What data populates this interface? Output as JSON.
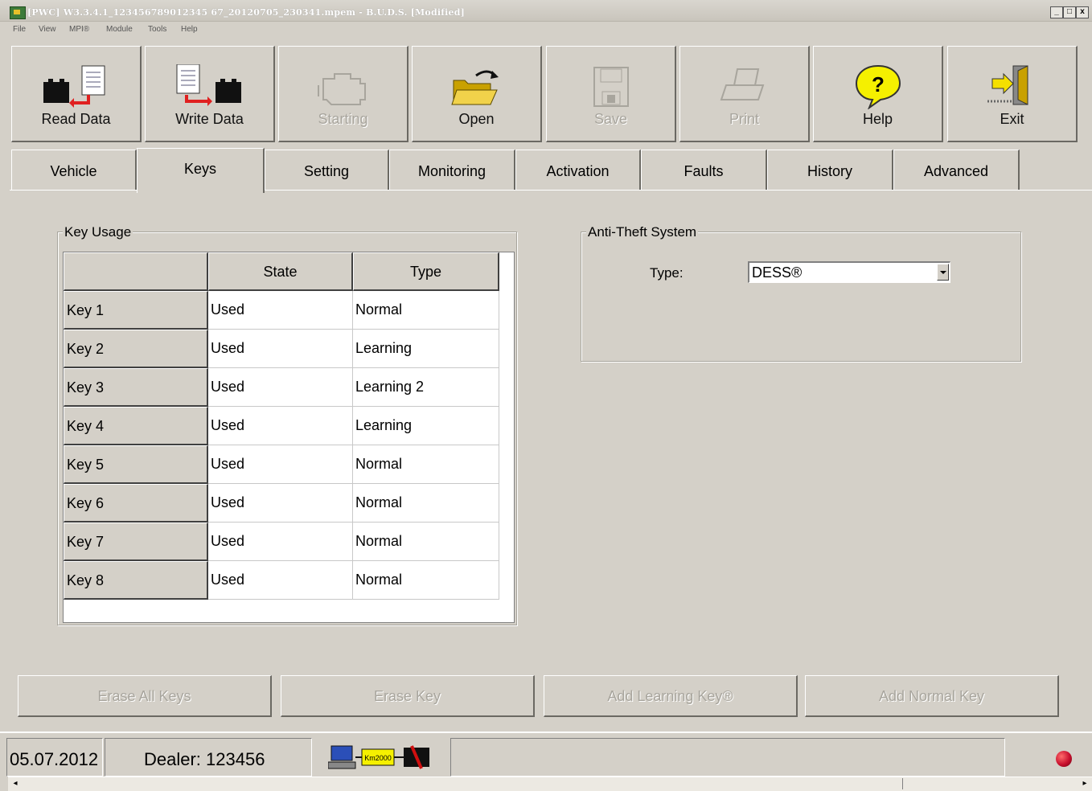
{
  "window": {
    "title": "[PWC] W3.3.4.1_123456789012345 67_20120705_230341.mpem - B.U.D.S. [Modified]",
    "controls": [
      "_",
      "□",
      "x"
    ]
  },
  "menu": [
    "File",
    "View",
    "MPI®",
    "Module",
    "Tools",
    "Help"
  ],
  "toolbar": [
    {
      "label": "Read Data",
      "icon": "read-data-icon",
      "enabled": true
    },
    {
      "label": "Write Data",
      "icon": "write-data-icon",
      "enabled": true
    },
    {
      "label": "Starting",
      "icon": "engine-icon",
      "enabled": false
    },
    {
      "label": "Open",
      "icon": "folder-open-icon",
      "enabled": true
    },
    {
      "label": "Save",
      "icon": "floppy-disk-icon",
      "enabled": false
    },
    {
      "label": "Print",
      "icon": "printer-icon",
      "enabled": false
    },
    {
      "label": "Help",
      "icon": "help-question-icon",
      "enabled": true
    },
    {
      "label": "Exit",
      "icon": "exit-door-icon",
      "enabled": true
    }
  ],
  "tabs": [
    "Vehicle",
    "Keys",
    "Setting",
    "Monitoring",
    "Activation",
    "Faults",
    "History",
    "Advanced"
  ],
  "active_tab": "Keys",
  "key_usage": {
    "legend": "Key Usage",
    "columns": [
      "State",
      "Type"
    ],
    "rows": [
      {
        "key": "Key 1",
        "state": "Used",
        "type": "Normal"
      },
      {
        "key": "Key 2",
        "state": "Used",
        "type": "Learning"
      },
      {
        "key": "Key 3",
        "state": "Used",
        "type": "Learning 2"
      },
      {
        "key": "Key 4",
        "state": "Used",
        "type": "Learning"
      },
      {
        "key": "Key 5",
        "state": "Used",
        "type": "Normal"
      },
      {
        "key": "Key 6",
        "state": "Used",
        "type": "Normal"
      },
      {
        "key": "Key 7",
        "state": "Used",
        "type": "Normal"
      },
      {
        "key": "Key 8",
        "state": "Used",
        "type": "Normal"
      }
    ]
  },
  "anti_theft": {
    "legend": "Anti-Theft System",
    "type_label": "Type:",
    "type_value": "DESS®"
  },
  "actions": [
    {
      "label": "Erase All Keys",
      "enabled": false
    },
    {
      "label": "Erase Key",
      "enabled": false
    },
    {
      "label": "Add Learning Key®",
      "enabled": false
    },
    {
      "label": "Add Normal Key",
      "enabled": false
    }
  ],
  "status": {
    "date": "05.07.2012",
    "dealer": "Dealer: 123456",
    "interface_label": "Km2000",
    "indicator_color": "#c8102e"
  }
}
